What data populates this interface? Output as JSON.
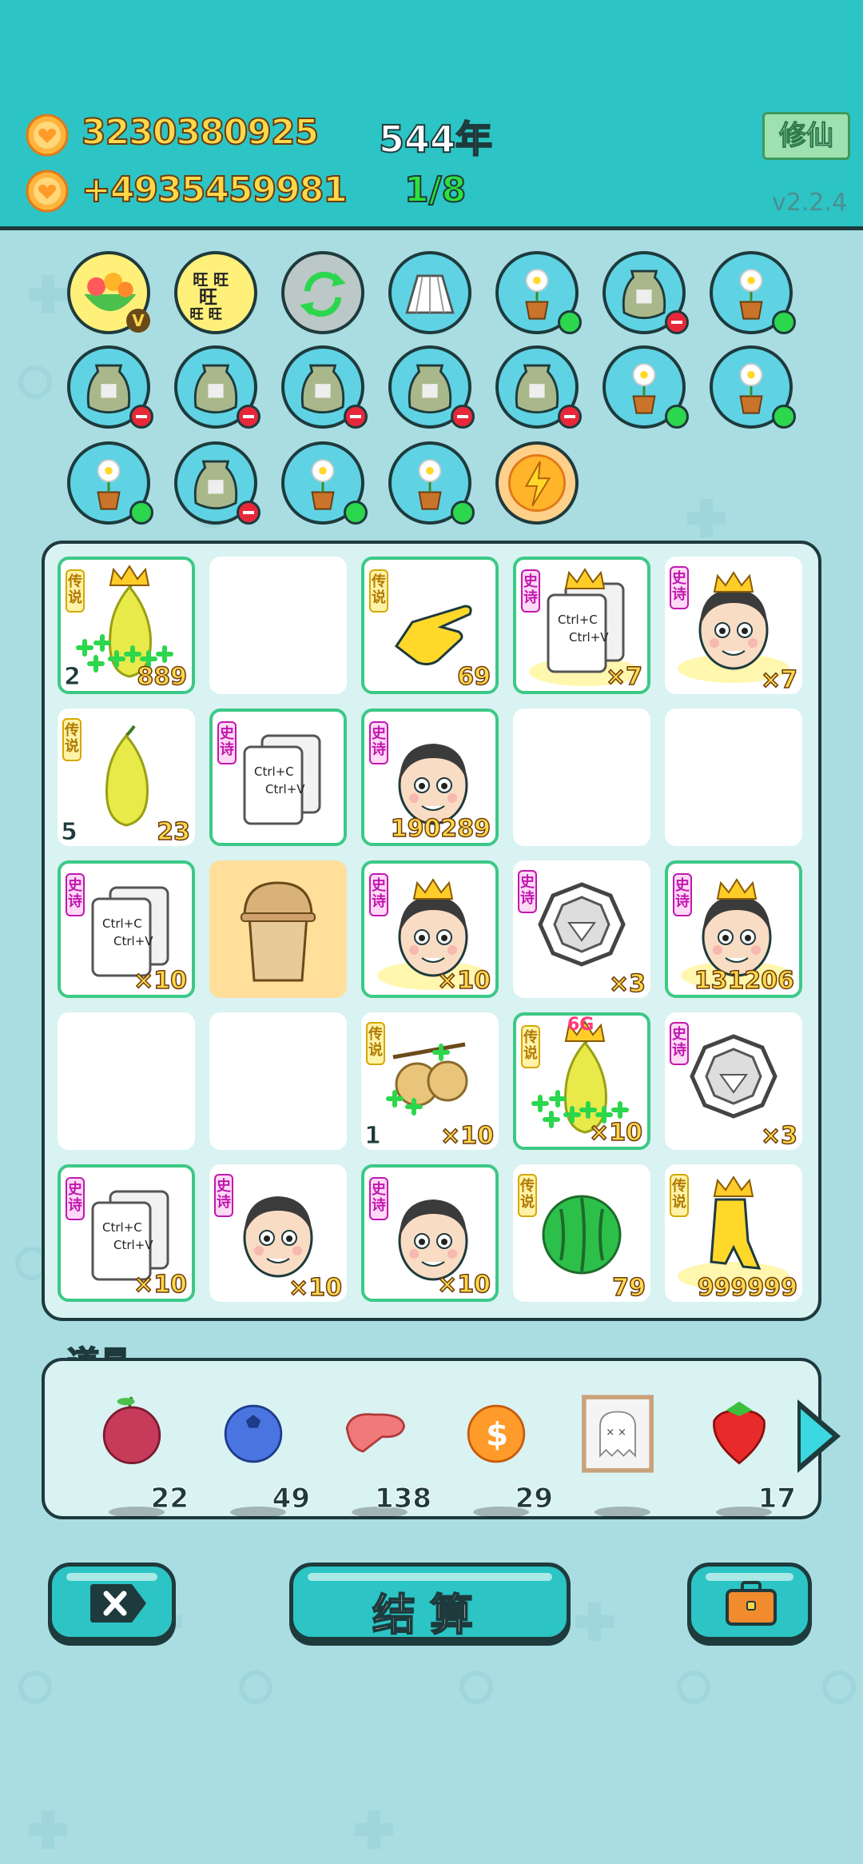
{
  "header": {
    "coins": "3230380925",
    "income": "+4935459981",
    "years": "544年",
    "progress": "1/8",
    "cultivate_button": "修仙",
    "version": "v2.2.4"
  },
  "relics": [
    {
      "icon": "fruit-basket-icon",
      "style": "yellow",
      "badge": "none",
      "overlay": "V"
    },
    {
      "icon": "wang-text-icon",
      "style": "yellow",
      "badge": "none",
      "overlay": "旺旺旺旺旺旺"
    },
    {
      "icon": "refresh-icon",
      "style": "gray",
      "badge": "none",
      "overlay": ""
    },
    {
      "icon": "skirt-icon",
      "style": "blue",
      "badge": "none",
      "overlay": ""
    },
    {
      "icon": "flower-pot-icon",
      "style": "blue",
      "badge": "green",
      "overlay": ""
    },
    {
      "icon": "sack-icon",
      "style": "blue",
      "badge": "red",
      "overlay": ""
    },
    {
      "icon": "flower-pot-icon",
      "style": "blue",
      "badge": "green",
      "overlay": ""
    },
    {
      "icon": "sack-icon",
      "style": "blue",
      "badge": "red",
      "overlay": ""
    },
    {
      "icon": "sack-icon",
      "style": "blue",
      "badge": "red",
      "overlay": ""
    },
    {
      "icon": "sack-icon",
      "style": "blue",
      "badge": "red",
      "overlay": ""
    },
    {
      "icon": "sack-icon",
      "style": "blue",
      "badge": "red",
      "overlay": ""
    },
    {
      "icon": "sack-icon",
      "style": "blue",
      "badge": "red",
      "overlay": ""
    },
    {
      "icon": "flower-pot-icon",
      "style": "blue",
      "badge": "green",
      "overlay": ""
    },
    {
      "icon": "flower-pot-icon",
      "style": "blue",
      "badge": "green",
      "overlay": ""
    },
    {
      "icon": "flower-pot-icon",
      "style": "blue",
      "badge": "green",
      "overlay": ""
    },
    {
      "icon": "sack-icon",
      "style": "blue",
      "badge": "red",
      "overlay": ""
    },
    {
      "icon": "flower-pot-icon",
      "style": "blue",
      "badge": "green",
      "overlay": ""
    },
    {
      "icon": "flower-pot-icon",
      "style": "blue",
      "badge": "green",
      "overlay": ""
    },
    {
      "icon": "lightning-icon",
      "style": "orange",
      "badge": "none",
      "overlay": ""
    }
  ],
  "board": [
    {
      "kind": "pear-crown-icon",
      "tag": "传说",
      "tag_type": "legend",
      "value": "889",
      "left": "2",
      "border": "green",
      "bg": "white"
    },
    {
      "kind": "empty",
      "tag": "",
      "tag_type": "",
      "value": "",
      "left": "",
      "border": "none",
      "bg": "white"
    },
    {
      "kind": "pointing-hand-icon",
      "tag": "传说",
      "tag_type": "legend",
      "value": "69",
      "left": "",
      "border": "green",
      "bg": "white"
    },
    {
      "kind": "copy-paste-crown-icon",
      "tag": "史诗",
      "tag_type": "epic",
      "value": "×7",
      "left": "",
      "border": "green",
      "bg": "white"
    },
    {
      "kind": "face-crown-icon",
      "tag": "史诗",
      "tag_type": "epic",
      "value": "×7",
      "left": "",
      "border": "none",
      "bg": "white"
    },
    {
      "kind": "pear-icon",
      "tag": "传说",
      "tag_type": "legend",
      "value": "23",
      "left": "5",
      "border": "none",
      "bg": "white"
    },
    {
      "kind": "copy-paste-icon",
      "tag": "史诗",
      "tag_type": "epic",
      "value": "",
      "left": "",
      "border": "green",
      "bg": "white"
    },
    {
      "kind": "face-icon",
      "tag": "史诗",
      "tag_type": "epic",
      "value": "190289",
      "left": "",
      "border": "green",
      "bg": "white"
    },
    {
      "kind": "empty",
      "tag": "",
      "tag_type": "",
      "value": "",
      "left": "",
      "border": "none",
      "bg": "white"
    },
    {
      "kind": "empty",
      "tag": "",
      "tag_type": "",
      "value": "",
      "left": "",
      "border": "none",
      "bg": "white"
    },
    {
      "kind": "copy-paste-icon",
      "tag": "史诗",
      "tag_type": "epic",
      "value": "×10",
      "left": "",
      "border": "green",
      "bg": "white"
    },
    {
      "kind": "cup-icon",
      "tag": "",
      "tag_type": "",
      "value": "",
      "left": "",
      "border": "none",
      "bg": "amber"
    },
    {
      "kind": "face-crown-icon",
      "tag": "史诗",
      "tag_type": "epic",
      "value": "×10",
      "left": "",
      "border": "green",
      "bg": "white"
    },
    {
      "kind": "bagua-icon",
      "tag": "史诗",
      "tag_type": "epic",
      "value": "×3",
      "left": "",
      "border": "none",
      "bg": "white"
    },
    {
      "kind": "face-crown-icon",
      "tag": "史诗",
      "tag_type": "epic",
      "value": "131206",
      "left": "",
      "border": "green",
      "bg": "white"
    },
    {
      "kind": "empty",
      "tag": "",
      "tag_type": "",
      "value": "",
      "left": "",
      "border": "none",
      "bg": "white"
    },
    {
      "kind": "empty",
      "tag": "",
      "tag_type": "",
      "value": "",
      "left": "",
      "border": "none",
      "bg": "white"
    },
    {
      "kind": "longan-icon",
      "tag": "传说",
      "tag_type": "legend",
      "value": "×10",
      "left": "1",
      "border": "none",
      "bg": "white"
    },
    {
      "kind": "pear-crown-6g-icon",
      "tag": "传说",
      "tag_type": "legend",
      "value": "×10",
      "left": "",
      "border": "green",
      "bg": "white"
    },
    {
      "kind": "bagua-icon",
      "tag": "史诗",
      "tag_type": "epic",
      "value": "×3",
      "left": "",
      "border": "none",
      "bg": "white"
    },
    {
      "kind": "copy-paste-icon",
      "tag": "史诗",
      "tag_type": "epic",
      "value": "×10",
      "left": "",
      "border": "green",
      "bg": "white"
    },
    {
      "kind": "face-icon",
      "tag": "史诗",
      "tag_type": "epic",
      "value": "×10",
      "left": "",
      "border": "none",
      "bg": "white"
    },
    {
      "kind": "face-icon",
      "tag": "史诗",
      "tag_type": "epic",
      "value": "×10",
      "left": "",
      "border": "green",
      "bg": "white"
    },
    {
      "kind": "watermelon-icon",
      "tag": "传说",
      "tag_type": "legend",
      "value": "79",
      "left": "",
      "border": "none",
      "bg": "white"
    },
    {
      "kind": "hand-crown-icon",
      "tag": "传说",
      "tag_type": "legend",
      "value": "999999",
      "left": "",
      "border": "none",
      "bg": "white"
    }
  ],
  "props": {
    "title": "道具",
    "items": [
      {
        "icon": "lychee-icon",
        "count": "22"
      },
      {
        "icon": "blueberry-icon",
        "count": "49"
      },
      {
        "icon": "liver-icon",
        "count": "138"
      },
      {
        "icon": "dollar-coin-icon",
        "count": "29"
      },
      {
        "icon": "ghost-frame-icon",
        "count": ""
      },
      {
        "icon": "strawberry-icon",
        "count": "17"
      }
    ]
  },
  "buttons": {
    "settle_label": "结算"
  },
  "colors": {
    "header": "#2cc4c4",
    "background": "#a9dde2",
    "outline": "#1e3a3c",
    "number_gold": "#ffd84a"
  }
}
